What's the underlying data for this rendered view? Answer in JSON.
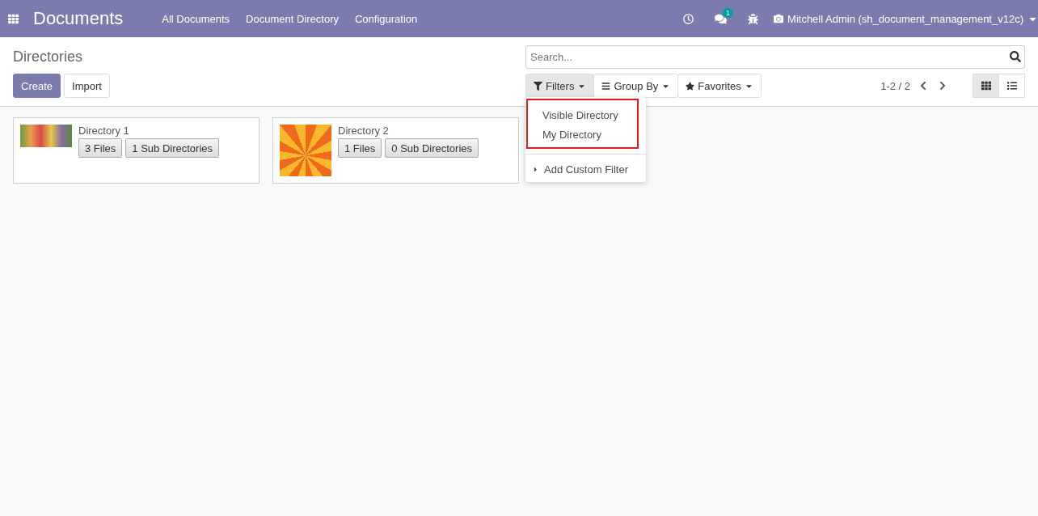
{
  "navbar": {
    "app_title": "Documents",
    "menu": [
      "All Documents",
      "Document Directory",
      "Configuration"
    ],
    "chat_badge": "1",
    "user": "Mitchell Admin (sh_document_management_v12c)"
  },
  "control_panel": {
    "title": "Directories",
    "buttons": [
      {
        "label": "Create",
        "kind": "primary"
      },
      {
        "label": "Import",
        "kind": "secondary"
      }
    ],
    "search": {
      "placeholder": "Search..."
    },
    "search_buttons": [
      {
        "label": "Filters",
        "kind": "filter",
        "selected": true
      },
      {
        "label": "Group By",
        "kind": "group",
        "selected": false
      },
      {
        "label": "Favorites",
        "kind": "star",
        "selected": false
      }
    ],
    "pager": "1-2 / 2",
    "views": [
      {
        "kind": "kanban",
        "selected": true
      },
      {
        "kind": "list",
        "selected": false
      }
    ]
  },
  "filters_menu": {
    "highlighted": [
      "Visible Directory",
      "My Directory"
    ],
    "custom": "Add Custom Filter"
  },
  "cards": [
    {
      "name": "Directory 1",
      "kind": "photo",
      "buttons": [
        "3 Files",
        "1 Sub Directories"
      ]
    },
    {
      "name": "Directory 2",
      "kind": "avatar",
      "buttons": [
        "1 Files",
        "0 Sub Directories"
      ]
    }
  ]
}
